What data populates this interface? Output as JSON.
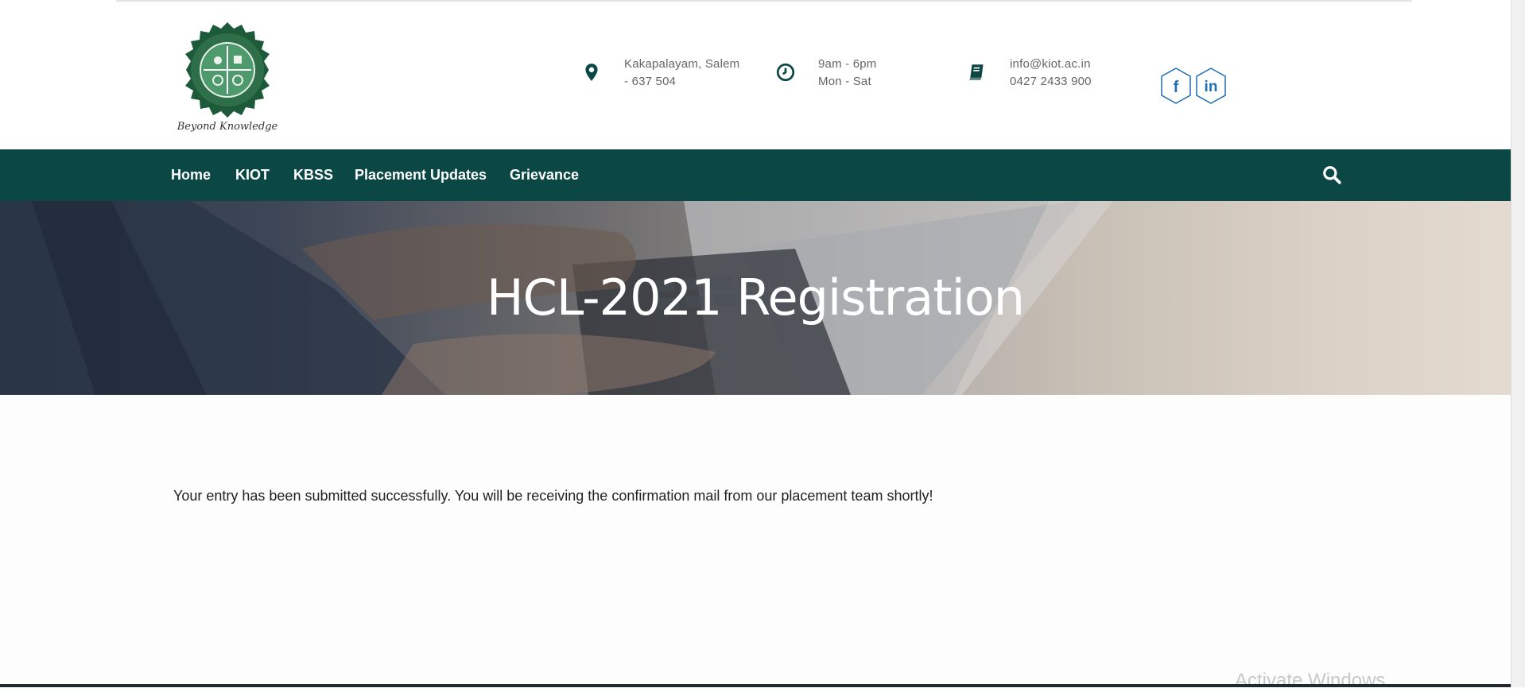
{
  "colors": {
    "primary": "#0b4744",
    "text": "#222222",
    "muted": "#666666",
    "social": "#1f6fb5"
  },
  "header": {
    "logo_tagline": "Beyond Knowledge",
    "location": {
      "icon": "map-marker-icon",
      "line1": "Kakapalayam, Salem",
      "line2": "- 637 504"
    },
    "hours": {
      "icon": "clock-icon",
      "line1": "9am - 6pm",
      "line2": "Mon - Sat"
    },
    "contact": {
      "icon": "book-icon",
      "line1": "info@kiot.ac.in",
      "line2": "0427 2433 900"
    },
    "social": [
      {
        "icon": "facebook-icon",
        "label": "f"
      },
      {
        "icon": "linkedin-icon",
        "label": "in"
      }
    ]
  },
  "nav": {
    "items": [
      {
        "label": "Home"
      },
      {
        "label": "KIOT"
      },
      {
        "label": "KBSS"
      },
      {
        "label": "Placement Updates"
      },
      {
        "label": "Grievance"
      }
    ],
    "search_icon": "search-icon"
  },
  "banner": {
    "title": "HCL-2021 Registration"
  },
  "main": {
    "message": "Your entry has been submitted successfully. You will be receiving the confirmation mail from our placement team shortly!"
  },
  "watermark": "Activate Windows"
}
